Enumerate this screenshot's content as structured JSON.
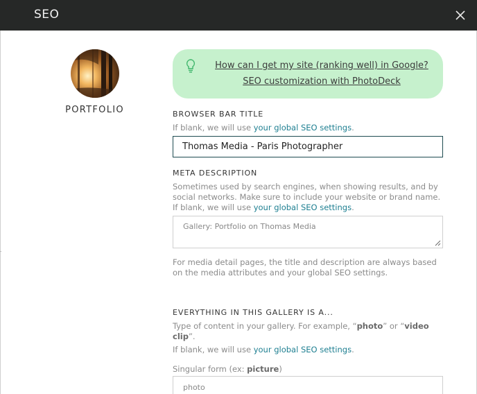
{
  "window": {
    "title": "SEO"
  },
  "gallery": {
    "name": "PORTFOLIO"
  },
  "tip": {
    "link1": "How can I get my site (ranking well) in Google?",
    "link2": "SEO customization with PhotoDeck"
  },
  "browser_bar": {
    "label": "BROWSER BAR TITLE",
    "help_prefix": "If blank, we will use ",
    "help_link": "your global SEO settings",
    "help_suffix": ".",
    "value": "Thomas Media - Paris Photographer"
  },
  "meta_description": {
    "label": "META DESCRIPTION",
    "help_text": "Sometimes used by search engines, when showing results, and by social networks. Make sure to include your website or brand name. If blank, we will use ",
    "help_link": "your global SEO settings",
    "help_suffix": ".",
    "placeholder": "Gallery:  Portfolio on Thomas Media",
    "media_note": "For media detail pages, the title and description are always based on the media attributes and your global SEO settings."
  },
  "content_type": {
    "label": "EVERYTHING IN THIS GALLERY IS A...",
    "help_a": "Type of content in your gallery. For example, “",
    "example1": "photo",
    "help_b": "” or “",
    "example2": "video clip",
    "help_c": "”.",
    "blank_prefix": "If blank, we will use ",
    "blank_link": "your global SEO settings",
    "blank_suffix": ".",
    "singular_prefix": "Singular form (ex: ",
    "singular_example": "picture",
    "singular_suffix": ")",
    "singular_placeholder": "photo"
  },
  "colors": {
    "titlebar": "#262827",
    "tip_background": "#c6f1cd",
    "link": "#1e7f91",
    "input_border_active": "#1d4a50"
  }
}
